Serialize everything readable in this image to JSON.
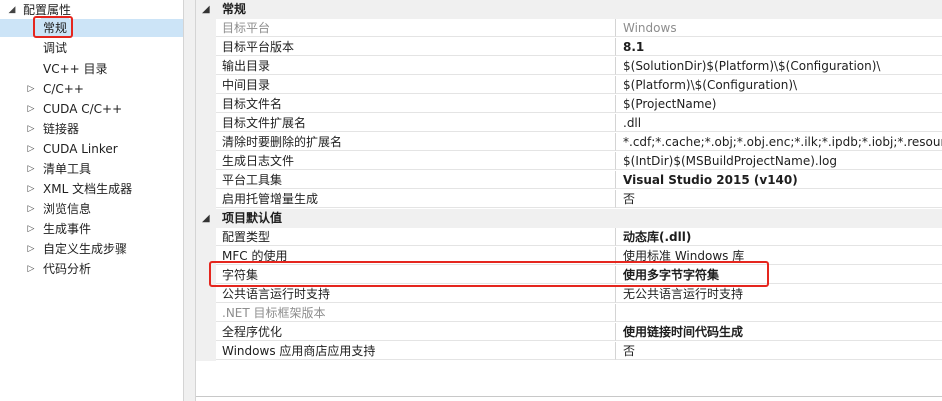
{
  "tree": {
    "root_label": "配置属性",
    "items": [
      {
        "label": "常规",
        "expandable": false,
        "selected": true
      },
      {
        "label": "调试",
        "expandable": false
      },
      {
        "label": "VC++ 目录",
        "expandable": false
      },
      {
        "label": "C/C++",
        "expandable": true
      },
      {
        "label": "CUDA C/C++",
        "expandable": true
      },
      {
        "label": "链接器",
        "expandable": true
      },
      {
        "label": "CUDA Linker",
        "expandable": true
      },
      {
        "label": "清单工具",
        "expandable": true
      },
      {
        "label": "XML 文档生成器",
        "expandable": true
      },
      {
        "label": "浏览信息",
        "expandable": true
      },
      {
        "label": "生成事件",
        "expandable": true
      },
      {
        "label": "自定义生成步骤",
        "expandable": true
      },
      {
        "label": "代码分析",
        "expandable": true
      }
    ]
  },
  "grid": {
    "categories": [
      {
        "label": "常规",
        "rows": [
          {
            "name": "目标平台",
            "value": "Windows",
            "disabled": true
          },
          {
            "name": "目标平台版本",
            "value": "8.1",
            "bold": true
          },
          {
            "name": "输出目录",
            "value": "$(SolutionDir)$(Platform)\\$(Configuration)\\"
          },
          {
            "name": "中间目录",
            "value": "$(Platform)\\$(Configuration)\\"
          },
          {
            "name": "目标文件名",
            "value": "$(ProjectName)"
          },
          {
            "name": "目标文件扩展名",
            "value": ".dll"
          },
          {
            "name": "清除时要删除的扩展名",
            "value": "*.cdf;*.cache;*.obj;*.obj.enc;*.ilk;*.ipdb;*.iobj;*.resources;"
          },
          {
            "name": "生成日志文件",
            "value": "$(IntDir)$(MSBuildProjectName).log"
          },
          {
            "name": "平台工具集",
            "value": "Visual Studio 2015 (v140)",
            "bold": true
          },
          {
            "name": "启用托管增量生成",
            "value": "否"
          }
        ]
      },
      {
        "label": "项目默认值",
        "rows": [
          {
            "name": "配置类型",
            "value": "动态库(.dll)",
            "bold": true
          },
          {
            "name": "MFC 的使用",
            "value": "使用标准 Windows 库"
          },
          {
            "name": "字符集",
            "value": "使用多字节字符集",
            "bold": true
          },
          {
            "name": "公共语言运行时支持",
            "value": "无公共语言运行时支持"
          },
          {
            "name": ".NET 目标框架版本",
            "value": "",
            "disabled": true
          },
          {
            "name": "全程序优化",
            "value": "使用链接时间代码生成",
            "bold": true
          },
          {
            "name": "Windows 应用商店应用支持",
            "value": "否"
          }
        ]
      }
    ]
  },
  "colors": {
    "highlight_box": "#e5261e",
    "selection": "#cce4f7",
    "category_bg": "#f0f0f0"
  }
}
